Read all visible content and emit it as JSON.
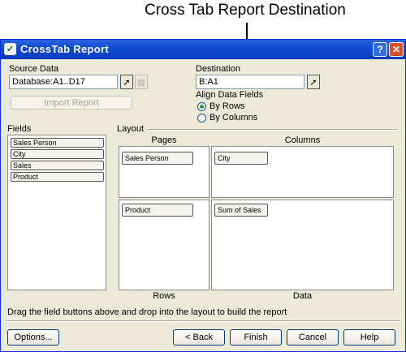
{
  "callout": {
    "text": "Cross Tab Report Destination"
  },
  "window": {
    "title": "CrossTab Report",
    "help_label": "?",
    "close_label": "✕"
  },
  "source": {
    "label": "Source Data",
    "value": "Database:A1..D17",
    "import_label": "Import Report"
  },
  "destination": {
    "label": "Destination",
    "value": "B:A1"
  },
  "align": {
    "label": "Align Data Fields",
    "options": [
      {
        "label": "By Rows",
        "selected": true
      },
      {
        "label": "By Columns",
        "selected": false
      }
    ]
  },
  "fields": {
    "label": "Fields",
    "items": [
      "Sales Person",
      "City",
      "Sales",
      "Product"
    ]
  },
  "layout": {
    "label": "Layout",
    "pages_label": "Pages",
    "columns_label": "Columns",
    "rows_label": "Rows",
    "data_label": "Data",
    "pages_field": "Sales Person",
    "columns_field": "City",
    "rows_field": "Product",
    "data_field": "Sum of Sales"
  },
  "hint": "Drag the field buttons above and drop into the layout to build the report",
  "buttons": {
    "options": "Options...",
    "back": "< Back",
    "finish": "Finish",
    "cancel": "Cancel",
    "help": "Help"
  },
  "icons": {
    "app": "crosstab-app-icon",
    "picker": "cursor-arrow-icon",
    "picker_disabled": "range-icon"
  },
  "colors": {
    "titlebar": "#0f4bd4",
    "dialog_bg": "#ece9d8",
    "radio_selected": "#21a121"
  }
}
